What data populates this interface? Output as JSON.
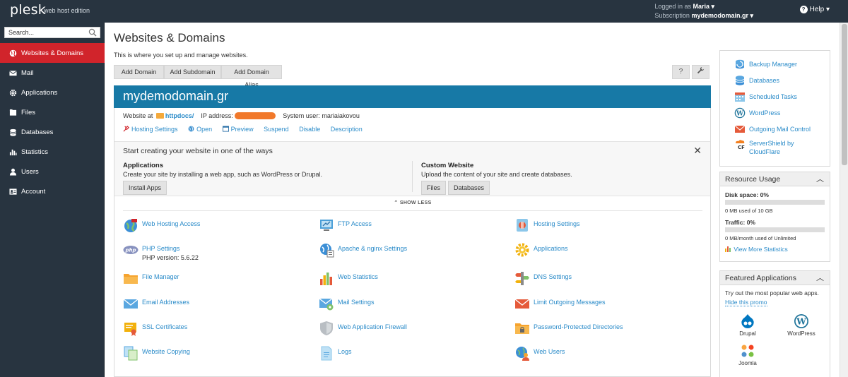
{
  "topbar": {
    "logo": "plesk",
    "edition": "web host edition",
    "logged_in_label": "Logged in as",
    "user": "Maria",
    "subscription_label": "Subscription",
    "subscription": "mydemodomain.gr",
    "help": "Help"
  },
  "sidebar": {
    "search_placeholder": "Search...",
    "items": [
      {
        "label": "Websites & Domains",
        "icon": "globe-icon",
        "active": true
      },
      {
        "label": "Mail",
        "icon": "mail-icon"
      },
      {
        "label": "Applications",
        "icon": "gear-icon"
      },
      {
        "label": "Files",
        "icon": "files-icon"
      },
      {
        "label": "Databases",
        "icon": "database-icon"
      },
      {
        "label": "Statistics",
        "icon": "statistics-icon"
      },
      {
        "label": "Users",
        "icon": "user-icon"
      },
      {
        "label": "Account",
        "icon": "account-icon"
      }
    ]
  },
  "main": {
    "title": "Websites & Domains",
    "subtitle": "This is where you set up and manage websites.",
    "toolbar": {
      "add_domain": "Add Domain",
      "add_subdomain": "Add Subdomain",
      "add_alias": "Add Domain Alias",
      "help_btn": "?",
      "tools_btn": "wrench-icon"
    },
    "domain": {
      "name": "mydemodomain.gr",
      "website_at_label": "Website at",
      "docroot": "httpdocs/",
      "ip_label": "IP address:",
      "system_user_label": "System user:",
      "system_user": "mariaiakovou",
      "links": [
        "Hosting Settings",
        "Open",
        "Preview",
        "Suspend",
        "Disable",
        "Description"
      ]
    },
    "promo": {
      "title": "Start creating your website in one of the ways",
      "apps_title": "Applications",
      "apps_text": "Create your site by installing a web app, such as WordPress or Drupal.",
      "install_apps": "Install Apps",
      "custom_title": "Custom Website",
      "custom_text": "Upload the content of your site and create databases.",
      "files_btn": "Files",
      "databases_btn": "Databases"
    },
    "show_less": "SHOW LESS",
    "features": [
      {
        "label": "Web Hosting Access",
        "icon": "web-hosting-access-icon"
      },
      {
        "label": "FTP Access",
        "icon": "ftp-access-icon"
      },
      {
        "label": "Hosting Settings",
        "icon": "hosting-settings-icon"
      },
      {
        "label": "PHP Settings",
        "icon": "php-icon",
        "sub": "PHP version: 5.6.22"
      },
      {
        "label": "Apache & nginx Settings",
        "icon": "apache-nginx-icon"
      },
      {
        "label": "Applications",
        "icon": "applications-gear-icon"
      },
      {
        "label": "File Manager",
        "icon": "folder-icon"
      },
      {
        "label": "Web Statistics",
        "icon": "bar-chart-icon"
      },
      {
        "label": "DNS Settings",
        "icon": "dns-icon"
      },
      {
        "label": "Email Addresses",
        "icon": "envelope-icon"
      },
      {
        "label": "Mail Settings",
        "icon": "mail-settings-icon"
      },
      {
        "label": "Limit Outgoing Messages",
        "icon": "limit-mail-icon"
      },
      {
        "label": "SSL Certificates",
        "icon": "certificate-icon"
      },
      {
        "label": "Web Application Firewall",
        "icon": "shield-icon"
      },
      {
        "label": "Password-Protected Directories",
        "icon": "locked-folder-icon"
      },
      {
        "label": "Website Copying",
        "icon": "copy-icon"
      },
      {
        "label": "Logs",
        "icon": "logs-icon"
      },
      {
        "label": "Web Users",
        "icon": "web-users-icon"
      }
    ]
  },
  "right": {
    "links": [
      {
        "label": "Backup Manager",
        "icon": "backup-icon"
      },
      {
        "label": "Databases",
        "icon": "database-icon"
      },
      {
        "label": "Scheduled Tasks",
        "icon": "calendar-icon"
      },
      {
        "label": "WordPress",
        "icon": "wordpress-icon"
      },
      {
        "label": "Outgoing Mail Control",
        "icon": "outgoing-mail-icon"
      },
      {
        "label": "ServerShield by CloudFlare",
        "icon": "cloudflare-icon"
      }
    ],
    "resource_usage": {
      "title": "Resource Usage",
      "disk_label": "Disk space: 0%",
      "disk_sub": "0 MB used of 10 GB",
      "disk_fraction": 0,
      "traffic_label": "Traffic: 0%",
      "traffic_sub": "0 MB/month used of Unlimited",
      "traffic_fraction": 0,
      "more_stats": "View More Statistics"
    },
    "featured": {
      "title": "Featured Applications",
      "text": "Try out the most popular web apps.",
      "hide": "Hide this promo",
      "apps": [
        "Drupal",
        "WordPress",
        "Joomla"
      ]
    }
  },
  "colors": {
    "topbar": "#283440",
    "active_nav": "#d1242b",
    "domain_header": "#1779a6",
    "link": "#2a8bc9"
  }
}
